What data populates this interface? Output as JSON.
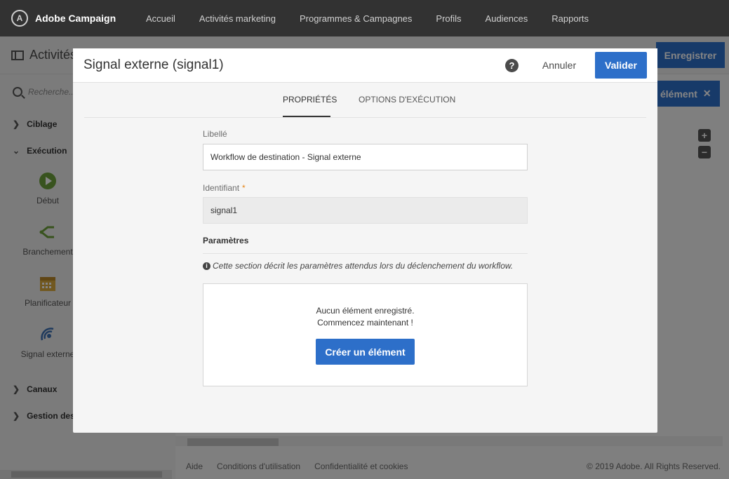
{
  "topbar": {
    "brand": "Adobe Campaign",
    "nav": [
      "Accueil",
      "Activités marketing",
      "Programmes & Campagnes",
      "Profils",
      "Audiences",
      "Rapports"
    ]
  },
  "background": {
    "title": "Activités",
    "save_label": "Enregistrer",
    "element_label": "élément",
    "search_placeholder": "Recherche...",
    "sections": {
      "ciblage": "Ciblage",
      "execution": "Exécution",
      "canaux": "Canaux",
      "gestion": "Gestion des"
    },
    "activities": {
      "debut": "Début",
      "branchement": "Branchement",
      "planificateur": "Planificateur",
      "signal": "Signal externe"
    },
    "footer": {
      "aide": "Aide",
      "conditions": "Conditions d'utilisation",
      "confidentialite": "Confidentialité et cookies",
      "copyright": "© 2019 Adobe. All Rights Reserved."
    }
  },
  "modal": {
    "title": "Signal externe (signal1)",
    "cancel_label": "Annuler",
    "validate_label": "Valider",
    "tabs": [
      "PROPRIÉTÉS",
      "OPTIONS D'EXÉCUTION"
    ],
    "label_field": {
      "label": "Libellé",
      "value": "Workflow de destination - Signal externe"
    },
    "id_field": {
      "label": "Identifiant",
      "required_mark": "*",
      "value": "signal1"
    },
    "params": {
      "title": "Paramètres",
      "info": "Cette section décrit les paramètres attendus lors du déclenchement du workflow.",
      "empty_line1": "Aucun élément enregistré.",
      "empty_line2": "Commencez maintenant !",
      "create_label": "Créer un élément"
    }
  },
  "colors": {
    "accent": "#2d6fc9",
    "topbar": "#323232",
    "required": "#e68619"
  }
}
